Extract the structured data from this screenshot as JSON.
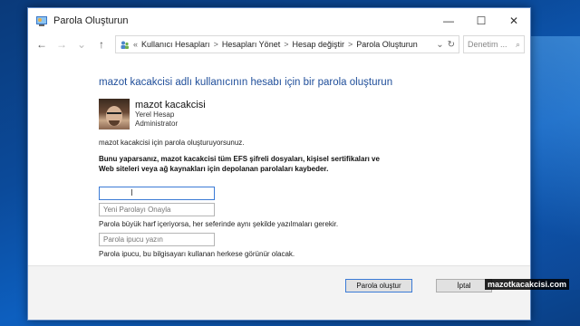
{
  "window": {
    "title": "Parola Oluşturun",
    "minimize": "—",
    "maximize": "☐",
    "close": "✕"
  },
  "address": {
    "back": "←",
    "forward": "→",
    "up": "↑",
    "chevron": "«",
    "crumbs": [
      "Kullanıcı Hesapları",
      "Hesapları Yönet",
      "Hesap değiştir",
      "Parola Oluşturun"
    ],
    "separator": ">",
    "dropdown": "⌄",
    "refresh": "↻",
    "search_placeholder": "Denetim ...",
    "search_icon": "⌕"
  },
  "main": {
    "heading": "mazot kacakcisi adlı kullanıcının hesabı için bir parola oluşturun",
    "user": {
      "name": "mazot kacakcisi",
      "account_type": "Yerel Hesap",
      "role": "Administrator"
    },
    "info": "mazot kacakcisi için parola oluşturuyorsunuz.",
    "warning": "Bunu yaparsanız, mazot kacakcisi tüm EFS şifreli dosyaları, kişisel sertifikaları ve Web siteleri veya ağ kaynakları için depolanan parolaları kaybeder.",
    "new_password": {
      "value": "",
      "caret": "I"
    },
    "confirm_placeholder": "Yeni Parolayı Onayla",
    "case_note": "Parola büyük harf içeriyorsa, her seferinde aynı şekilde yazılmaları gerekir.",
    "hint_placeholder": "Parola ipucu yazın",
    "hint_note": "Parola ipucu, bu bilgisayarı kullanan herkese görünür olacak."
  },
  "buttons": {
    "create": "Parola oluştur",
    "cancel": "İptal"
  },
  "watermark": "mazotkacakcisi.com"
}
